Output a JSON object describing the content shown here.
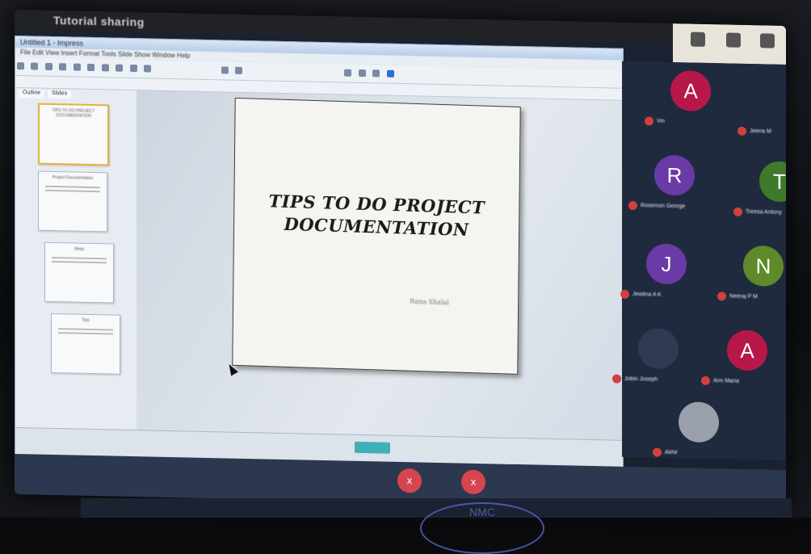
{
  "meeting": {
    "title": "Tutorial sharing",
    "shared_app_title": "Untitled 1 - Impress",
    "menu": "File  Edit  View  Insert  Format  Tools  Slide Show  Window  Help",
    "sidebar_tabs": [
      "Outline",
      "Slides"
    ]
  },
  "slide": {
    "title_line1": "TIPS TO DO PROJECT",
    "title_line2": "DOCUMENTATION",
    "subtitle": "Rana Shalal"
  },
  "thumbnails": [
    {
      "label": "TIPS TO DO PROJECT DOCUMENTATION"
    },
    {
      "label": "Project Documentation"
    },
    {
      "label": "Steps"
    },
    {
      "label": "Tips"
    }
  ],
  "participants": [
    {
      "initial": "A",
      "name": "Vin",
      "color": "#b8174a"
    },
    {
      "initial": "",
      "name": "Jeena M",
      "color": "#1f2a3f"
    },
    {
      "initial": "R",
      "name": "Rosemon George",
      "color": "#6a3aa6"
    },
    {
      "initial": "T",
      "name": "Treesa Antony",
      "color": "#3f7a2a"
    },
    {
      "initial": "J",
      "name": "Jewlina A K",
      "color": "#6a3aa6"
    },
    {
      "initial": "N",
      "name": "Neeraj P M",
      "color": "#5f8a2a"
    },
    {
      "initial": "",
      "name": "Jobin Joseph",
      "color": "#2f3a55"
    },
    {
      "initial": "A",
      "name": "Ann Maria",
      "color": "#b8174a"
    },
    {
      "initial": "",
      "name": "Akhil",
      "color": "#9aa0ab"
    }
  ],
  "controls": {
    "mic": "x",
    "video": "x"
  },
  "watermark_text": "NMC"
}
